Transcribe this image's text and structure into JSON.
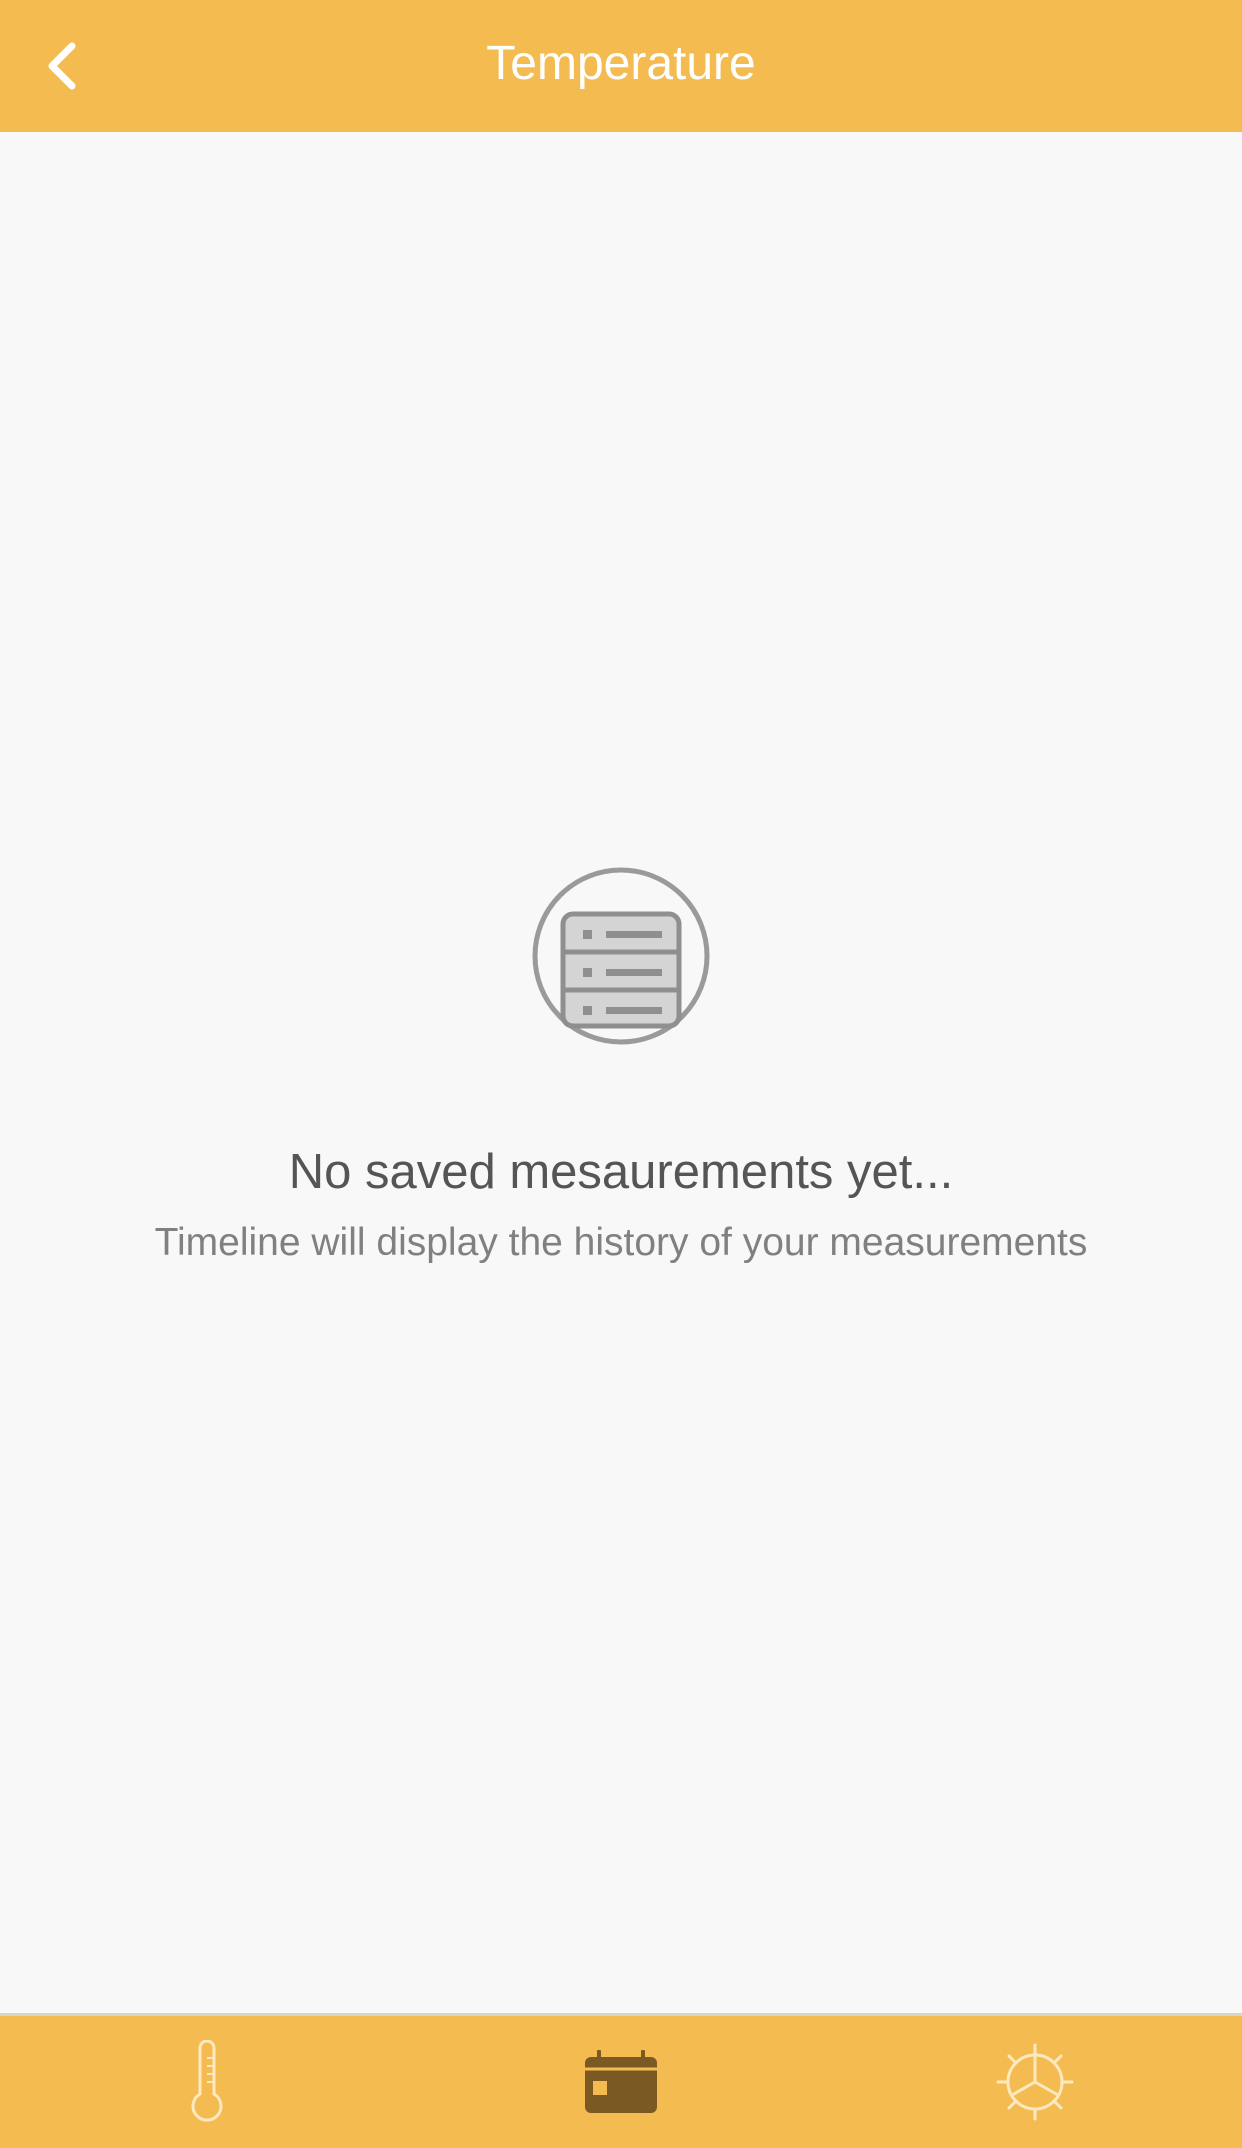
{
  "header": {
    "title": "Temperature",
    "back_icon": "chevron-left-icon"
  },
  "empty_state": {
    "icon": "list-storage-icon",
    "title": "No saved mesaurements yet...",
    "subtitle": "Timeline will display the history of your measurements"
  },
  "bottom_nav": {
    "items": [
      {
        "icon": "thermometer-icon",
        "active": false
      },
      {
        "icon": "calendar-icon",
        "active": true
      },
      {
        "icon": "settings-gear-icon",
        "active": false
      }
    ]
  },
  "colors": {
    "accent": "#f4bb51",
    "active_icon": "#7a5a22",
    "inactive_icon": "#fde9c0",
    "background": "#f8f8f8"
  }
}
